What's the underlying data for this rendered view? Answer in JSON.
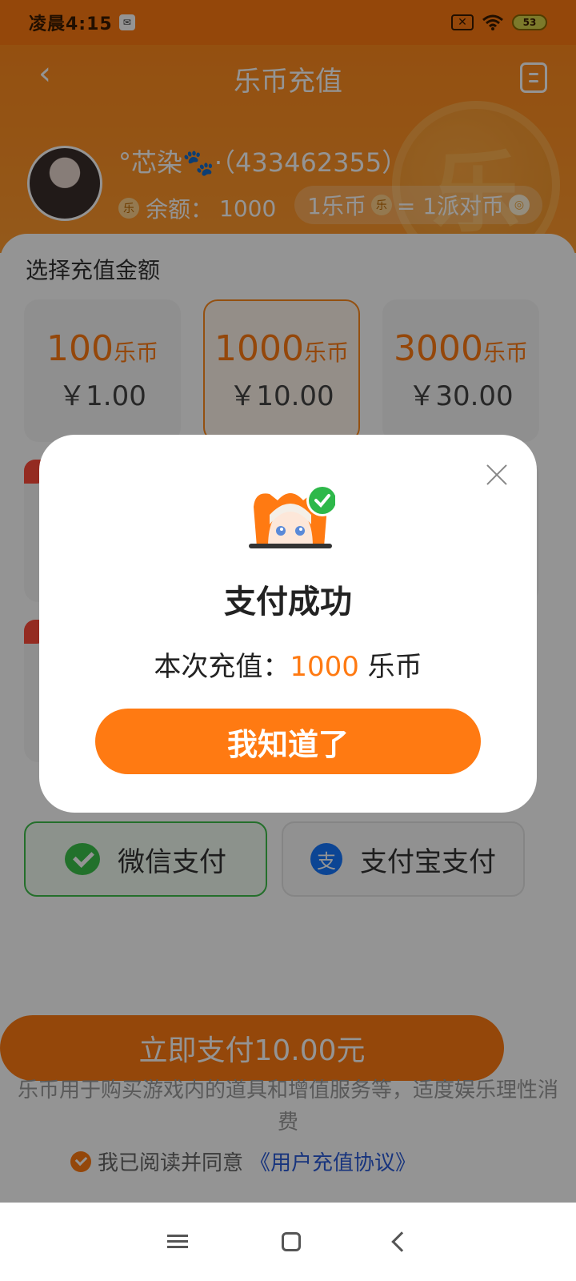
{
  "status_bar": {
    "time": "凌晨4:15",
    "battery": "53"
  },
  "header": {
    "title": "乐币充值",
    "coin_glyph": "乐",
    "username": "°芯染🐾·（433462355）",
    "balance_label": "余额：",
    "balance_value": "1000",
    "rate_left": "1乐币",
    "rate_right": "= 1派对币"
  },
  "main": {
    "section_title": "选择充值金额",
    "options": [
      {
        "coins": "100",
        "unit": "乐币",
        "price": "￥1.00",
        "selected": false
      },
      {
        "coins": "1000",
        "unit": "乐币",
        "price": "￥10.00",
        "selected": true
      },
      {
        "coins": "3000",
        "unit": "乐币",
        "price": "￥30.00",
        "selected": false
      }
    ],
    "pay_methods": {
      "wechat": "微信支付",
      "alipay": "支付宝支付"
    },
    "pay_now": "立即支付10.00元",
    "notice": "乐币用于购买游戏内的道具和增值服务等，适度娱乐理性消费",
    "agree_text": "我已阅读并同意",
    "agree_link": "《用户充值协议》"
  },
  "modal": {
    "title": "支付成功",
    "desc_prefix": "本次充值：",
    "desc_amount": "1000",
    "desc_unit": " 乐币",
    "button": "我知道了"
  },
  "icons": [
    "back-icon",
    "record-icon",
    "wechat-icon",
    "alipay-icon",
    "close-icon",
    "check-icon",
    "menu-icon",
    "home-icon"
  ],
  "colors": {
    "accent": "#ff7a12",
    "wechat": "#3cc34a",
    "alipay": "#1677ff",
    "link": "#2a5bd7"
  }
}
